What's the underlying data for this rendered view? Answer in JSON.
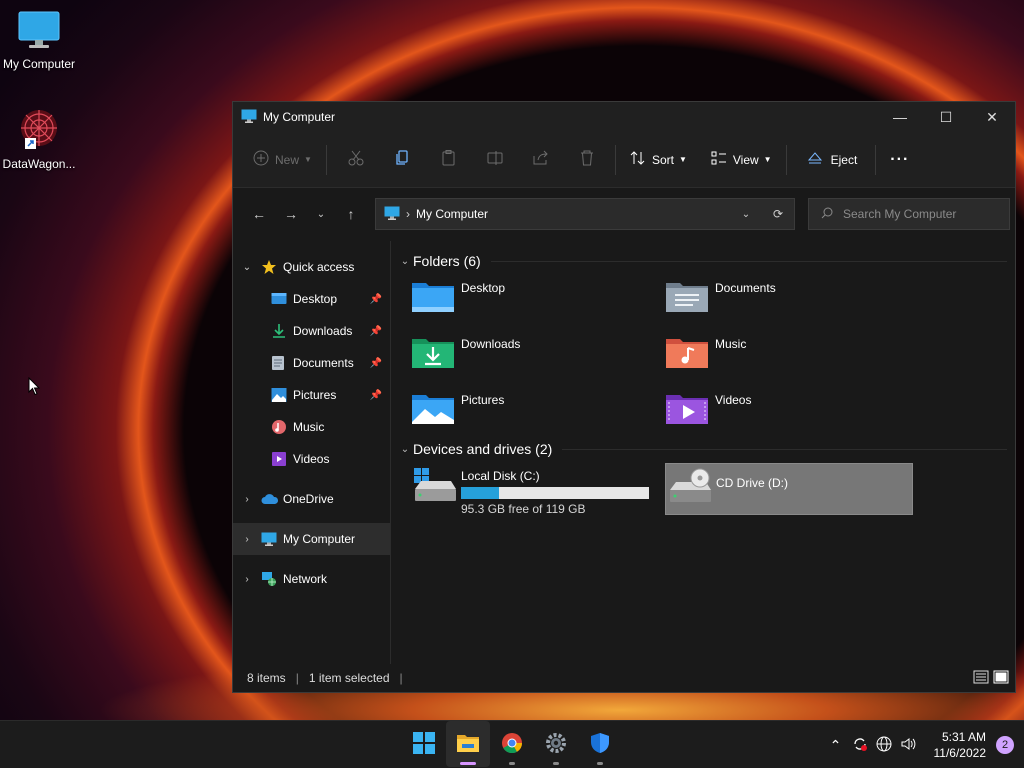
{
  "desktop": {
    "icons": [
      {
        "label": "My Computer"
      },
      {
        "label": "DataWagon..."
      }
    ]
  },
  "window": {
    "title": "My Computer",
    "controls": {
      "minimize": "—",
      "maximize": "☐",
      "close": "✕"
    }
  },
  "toolbar": {
    "new_label": "New",
    "sort_label": "Sort",
    "view_label": "View",
    "eject_label": "Eject",
    "more_label": "···"
  },
  "address": {
    "crumb": "My Computer",
    "search_placeholder": "Search My Computer"
  },
  "sidebar": {
    "quick_access": "Quick access",
    "items": [
      {
        "label": "Desktop",
        "pinned": true
      },
      {
        "label": "Downloads",
        "pinned": true
      },
      {
        "label": "Documents",
        "pinned": true
      },
      {
        "label": "Pictures",
        "pinned": true
      },
      {
        "label": "Music",
        "pinned": false
      },
      {
        "label": "Videos",
        "pinned": false
      }
    ],
    "onedrive": "OneDrive",
    "my_computer": "My Computer",
    "network": "Network"
  },
  "content": {
    "folders_header": "Folders (6)",
    "folders": [
      {
        "name": "Desktop"
      },
      {
        "name": "Documents"
      },
      {
        "name": "Downloads"
      },
      {
        "name": "Music"
      },
      {
        "name": "Pictures"
      },
      {
        "name": "Videos"
      }
    ],
    "drives_header": "Devices and drives (2)",
    "drives": [
      {
        "name": "Local Disk (C:)",
        "free_text": "95.3 GB free of 119 GB",
        "used_fraction": 0.2
      },
      {
        "name": "CD Drive (D:)"
      }
    ]
  },
  "status": {
    "items": "8 items",
    "selected": "1 item selected"
  },
  "taskbar": {
    "time": "5:31 AM",
    "date": "11/6/2022",
    "notification_count": "2"
  }
}
